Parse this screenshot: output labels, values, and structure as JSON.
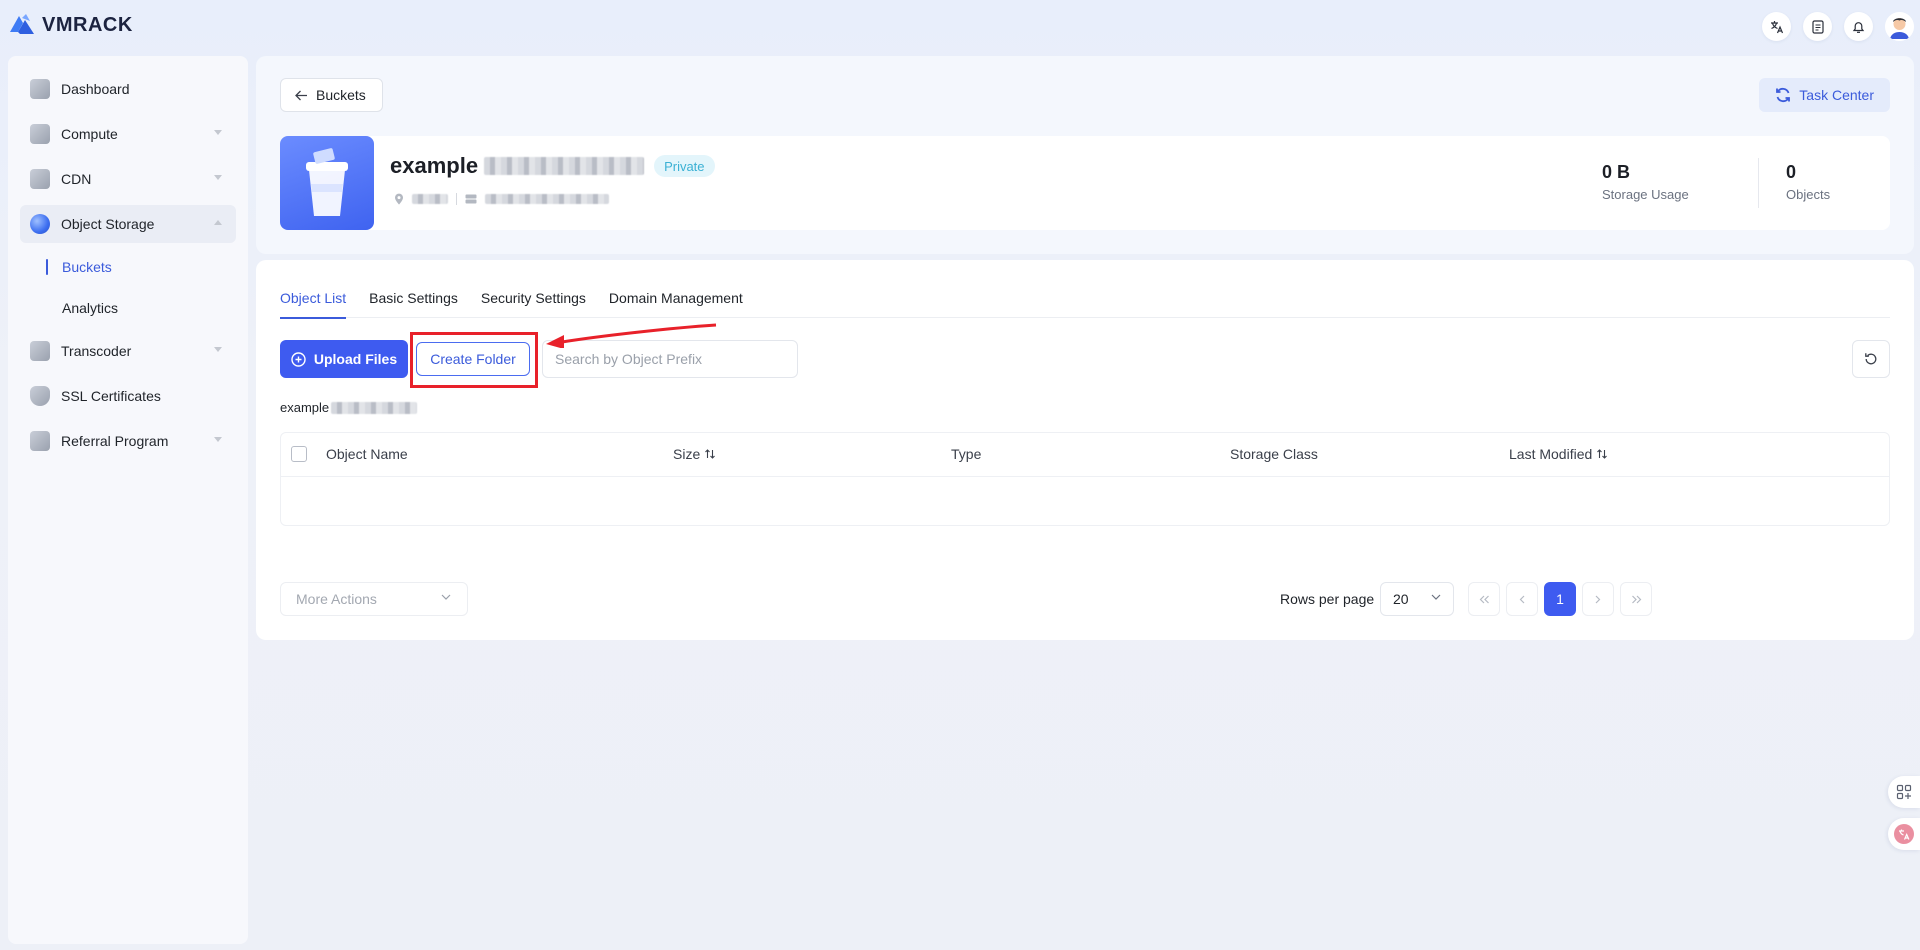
{
  "brand": {
    "name": "VMRACK"
  },
  "sidebar": {
    "items": [
      {
        "label": "Dashboard"
      },
      {
        "label": "Compute"
      },
      {
        "label": "CDN"
      },
      {
        "label": "Object Storage"
      },
      {
        "label": "Transcoder"
      },
      {
        "label": "SSL Certificates"
      },
      {
        "label": "Referral Program"
      }
    ],
    "sub_items": [
      {
        "label": "Buckets"
      },
      {
        "label": "Analytics"
      }
    ]
  },
  "header": {
    "back_label": "Buckets",
    "task_center_label": "Task Center",
    "bucket": {
      "name": "example",
      "badge": "Private"
    },
    "stats": [
      {
        "value": "0 B",
        "label": "Storage Usage"
      },
      {
        "value": "0",
        "label": "Objects"
      }
    ]
  },
  "tabs": [
    {
      "label": "Object List"
    },
    {
      "label": "Basic Settings"
    },
    {
      "label": "Security Settings"
    },
    {
      "label": "Domain Management"
    }
  ],
  "toolbar": {
    "upload_label": "Upload Files",
    "create_folder_label": "Create Folder",
    "search_placeholder": "Search by Object Prefix"
  },
  "breadcrumb": {
    "root": "example"
  },
  "table": {
    "columns": [
      {
        "label": "Object Name"
      },
      {
        "label": "Size"
      },
      {
        "label": "Type"
      },
      {
        "label": "Storage Class"
      },
      {
        "label": "Last Modified"
      }
    ]
  },
  "footer": {
    "more_actions_label": "More Actions",
    "rows_per_page_label": "Rows per page",
    "rows_per_page_value": "20",
    "current_page": "1"
  },
  "colors": {
    "accent": "#3e5bf0",
    "annotation": "#e8212a",
    "private_badge": "#3bb1d4"
  }
}
